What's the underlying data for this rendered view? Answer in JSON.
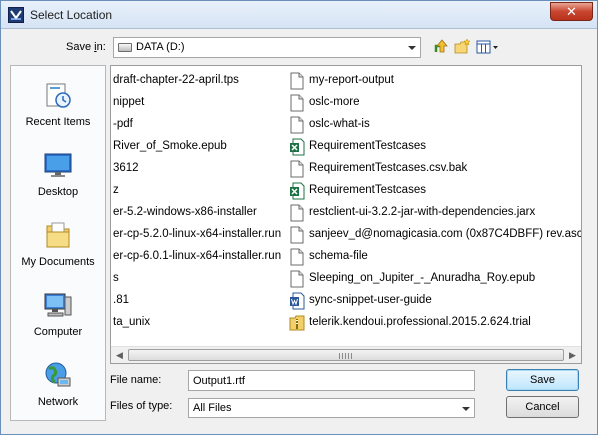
{
  "window": {
    "title": "Select Location",
    "close_glyph": "✕"
  },
  "save_in": {
    "label_prefix": "Save ",
    "label_accel": "i",
    "label_suffix": "n:",
    "value": "DATA (D:)",
    "drive_icon": "hard-drive-icon"
  },
  "toolbar": {
    "up_icon": "up-one-level-icon",
    "new_folder_icon": "new-folder-icon",
    "view_icon": "view-menu-icon"
  },
  "places": [
    {
      "label": "Recent Items",
      "icon": "recent-items-icon"
    },
    {
      "label": "Desktop",
      "icon": "desktop-icon"
    },
    {
      "label": "My Documents",
      "icon": "my-documents-icon"
    },
    {
      "label": "Computer",
      "icon": "computer-icon"
    },
    {
      "label": "Network",
      "icon": "network-icon"
    }
  ],
  "files": {
    "left": [
      "draft-chapter-22-april.tps",
      "nippet",
      "-pdf",
      "River_of_Smoke.epub",
      "3612",
      "z",
      "er-5.2-windows-x86-installer",
      "er-cp-5.2.0-linux-x64-installer.run",
      "er-cp-6.0.1-linux-x64-installer.run",
      "s",
      ".81",
      "ta_unix"
    ],
    "right": [
      {
        "name": "my-report-output",
        "icon": "file-icon"
      },
      {
        "name": "oslc-more",
        "icon": "file-icon"
      },
      {
        "name": "oslc-what-is",
        "icon": "file-icon"
      },
      {
        "name": "RequirementTestcases",
        "icon": "excel-icon"
      },
      {
        "name": "RequirementTestcases.csv.bak",
        "icon": "file-icon"
      },
      {
        "name": "RequirementTestcases",
        "icon": "excel-icon"
      },
      {
        "name": "restclient-ui-3.2.2-jar-with-dependencies.jarx",
        "icon": "file-icon"
      },
      {
        "name": "sanjeev_d@nomagicasia.com (0x87C4DBFF) rev.asc",
        "icon": "file-icon"
      },
      {
        "name": "schema-file",
        "icon": "file-icon"
      },
      {
        "name": "Sleeping_on_Jupiter_-_Anuradha_Roy.epub",
        "icon": "file-icon"
      },
      {
        "name": "sync-snippet-user-guide",
        "icon": "word-icon"
      },
      {
        "name": "telerik.kendoui.professional.2015.2.624.trial",
        "icon": "archive-icon"
      }
    ]
  },
  "file_name": {
    "label": "File name:",
    "value": "Output1.rtf"
  },
  "file_type": {
    "label": "Files of type:",
    "value": "All Files"
  },
  "buttons": {
    "save": "Save",
    "cancel": "Cancel"
  },
  "colors": {
    "title_bg": "#dbe7f5",
    "close_red": "#c94630",
    "default_btn": "#bee6fd"
  }
}
